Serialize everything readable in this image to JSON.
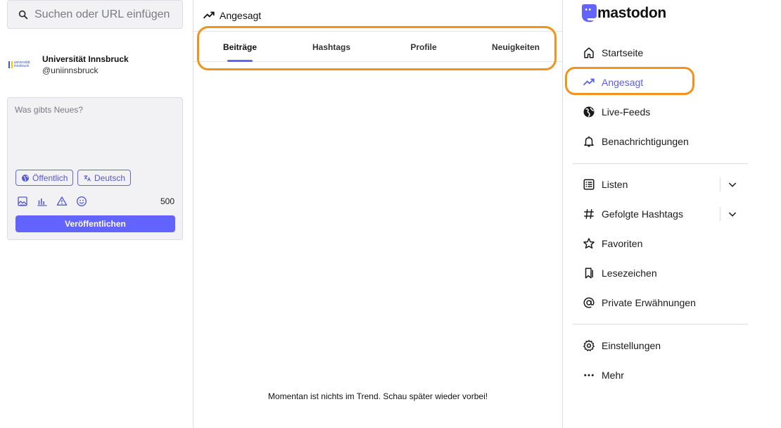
{
  "search": {
    "placeholder": "Suchen oder URL einfügen"
  },
  "account": {
    "name": "Universität Innsbruck",
    "handle": "@uniinnsbruck",
    "logo_text": "universität innsbruck"
  },
  "compose": {
    "placeholder": "Was gibts Neues?",
    "visibility_label": "Öffentlich",
    "language_label": "Deutsch",
    "char_count": "500",
    "publish_label": "Veröffentlichen"
  },
  "column": {
    "title": "Angesagt",
    "tabs": [
      {
        "label": "Beiträge",
        "active": true
      },
      {
        "label": "Hashtags",
        "active": false
      },
      {
        "label": "Profile",
        "active": false
      },
      {
        "label": "Neuigkeiten",
        "active": false
      }
    ],
    "empty_message": "Momentan ist nichts im Trend. Schau später wieder vorbei!"
  },
  "brand": {
    "name": "mastodon"
  },
  "nav": {
    "items": [
      {
        "label": "Startseite",
        "icon": "home-icon"
      },
      {
        "label": "Angesagt",
        "icon": "trending-icon",
        "active": true
      },
      {
        "label": "Live-Feeds",
        "icon": "globe-icon"
      },
      {
        "label": "Benachrichtigungen",
        "icon": "bell-icon"
      },
      {
        "label": "Listen",
        "icon": "list-icon"
      },
      {
        "label": "Gefolgte Hashtags",
        "icon": "hashtag-icon"
      },
      {
        "label": "Favoriten",
        "icon": "star-icon"
      },
      {
        "label": "Lesezeichen",
        "icon": "bookmark-icon"
      },
      {
        "label": "Private Erwähnungen",
        "icon": "at-icon"
      },
      {
        "label": "Einstellungen",
        "icon": "gear-icon"
      },
      {
        "label": "Mehr",
        "icon": "more-icon"
      }
    ]
  },
  "colors": {
    "accent": "#6364ff",
    "highlight": "#f0941c",
    "active_nav": "#5b5ef0"
  }
}
